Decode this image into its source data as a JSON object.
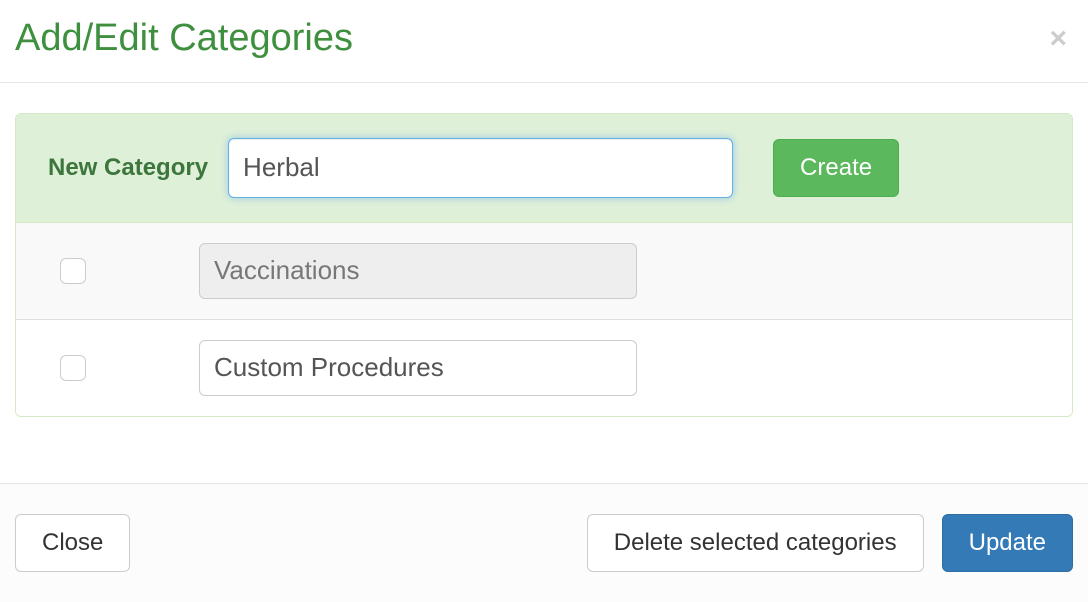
{
  "header": {
    "title": "Add/Edit Categories"
  },
  "newCategory": {
    "label": "New Category",
    "value": "Herbal",
    "createLabel": "Create"
  },
  "categories": [
    {
      "name": "Vaccinations",
      "locked": true
    },
    {
      "name": "Custom Procedures",
      "locked": false
    }
  ],
  "footer": {
    "close": "Close",
    "delete": "Delete selected categories",
    "update": "Update"
  }
}
